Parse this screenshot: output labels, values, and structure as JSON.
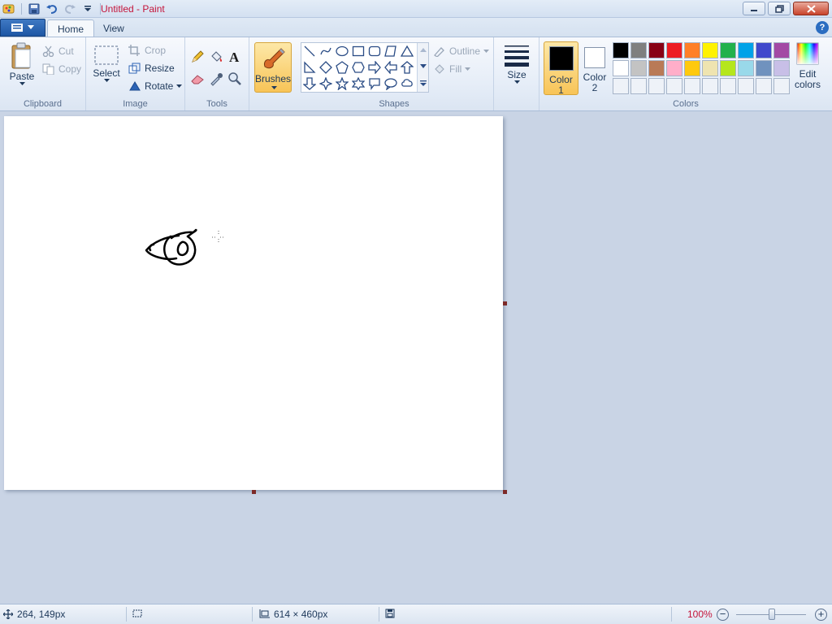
{
  "window": {
    "title": "Untitled - Paint"
  },
  "tabs": [
    {
      "label": "Home",
      "active": true
    },
    {
      "label": "View",
      "active": false
    }
  ],
  "clipboard": {
    "paste": "Paste",
    "cut": "Cut",
    "copy": "Copy",
    "group": "Clipboard"
  },
  "image": {
    "select": "Select",
    "crop": "Crop",
    "resize": "Resize",
    "rotate": "Rotate",
    "group": "Image"
  },
  "tools": {
    "group": "Tools",
    "icons": [
      "pencil-icon",
      "fill-icon",
      "text-icon",
      "eraser-icon",
      "color-picker-icon",
      "magnifier-icon"
    ]
  },
  "brushes": {
    "label": "Brushes"
  },
  "shapes": {
    "group": "Shapes",
    "outline": "Outline",
    "fill": "Fill"
  },
  "size": {
    "label": "Size"
  },
  "colors": {
    "group": "Colors",
    "color1_label": "Color",
    "color1_num": "1",
    "color2_label": "Color",
    "color2_num": "2",
    "edit_label": "Edit",
    "edit_label2": "colors",
    "color1_value": "#000000",
    "color2_value": "#ffffff",
    "palette": [
      "#000000",
      "#7f7f7f",
      "#880015",
      "#ed1c24",
      "#ff7f27",
      "#fff200",
      "#22b14c",
      "#00a2e8",
      "#3f48cc",
      "#a349a4",
      "#ffffff",
      "#c3c3c3",
      "#b97a57",
      "#ffaec9",
      "#ffc90e",
      "#efe4b0",
      "#b5e61d",
      "#99d9ea",
      "#7092be",
      "#c8bfe7",
      "",
      "",
      "",
      "",
      "",
      "",
      "",
      "",
      "",
      ""
    ]
  },
  "status": {
    "cursor": "264, 149px",
    "canvas_size": "614 × 460px",
    "zoom": "100%",
    "zoom_level": 1.0
  }
}
